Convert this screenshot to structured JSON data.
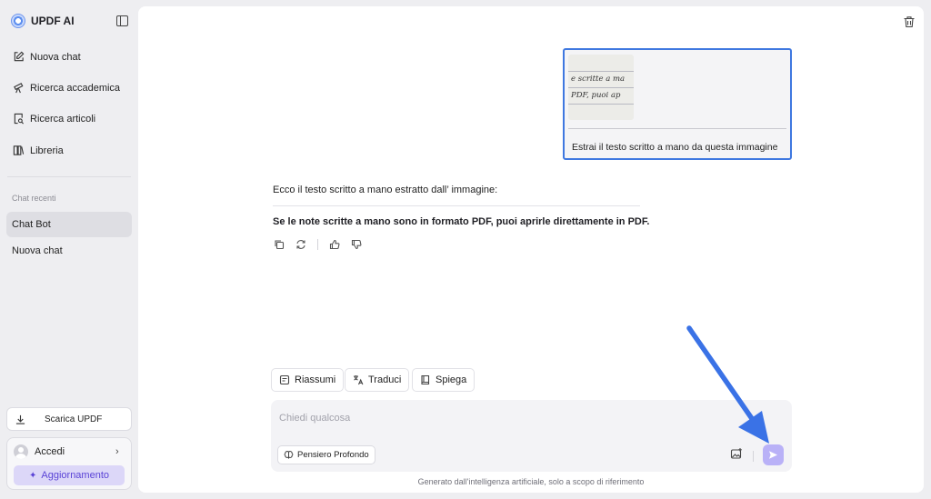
{
  "app": {
    "name": "UPDF AI"
  },
  "sidebar": {
    "nav": [
      {
        "label": "Nuova chat",
        "icon": "edit-icon"
      },
      {
        "label": "Ricerca accademica",
        "icon": "telescope-icon"
      },
      {
        "label": "Ricerca articoli",
        "icon": "doc-search-icon"
      },
      {
        "label": "Libreria",
        "icon": "library-icon"
      }
    ],
    "recent_label": "Chat recenti",
    "recent": [
      {
        "label": "Chat Bot",
        "active": true
      },
      {
        "label": "Nuova chat",
        "active": false
      }
    ],
    "download_label": "Scarica UPDF",
    "login_label": "Accedi",
    "upgrade_label": "Aggiornamento"
  },
  "conversation": {
    "user_message": "Estrai il testo scritto a mano da questa immagine",
    "image_lines": [
      "e scritte a ma",
      "PDF, puoi ap"
    ],
    "bot_intro": "Ecco il testo scritto a mano estratto dall’ immagine:",
    "bot_answer": "Se le note scritte a mano sono in formato PDF, puoi aprirle direttamente in PDF."
  },
  "chips": [
    {
      "label": "Riassumi",
      "icon": "summary-icon"
    },
    {
      "label": "Traduci",
      "icon": "translate-icon"
    },
    {
      "label": "Spiega",
      "icon": "book-icon"
    }
  ],
  "input": {
    "placeholder": "Chiedi qualcosa",
    "value": "",
    "deep_think_label": "Pensiero Profondo"
  },
  "footer_note": "Generato dall'intelligenza artificiale, solo a scopo di riferimento",
  "colors": {
    "accent": "#3f78e0",
    "send": "#b9b1f7",
    "upgrade_text": "#5a43d6",
    "upgrade_bg": "#dcd7f8",
    "annotation_arrow": "#3a72e6"
  }
}
